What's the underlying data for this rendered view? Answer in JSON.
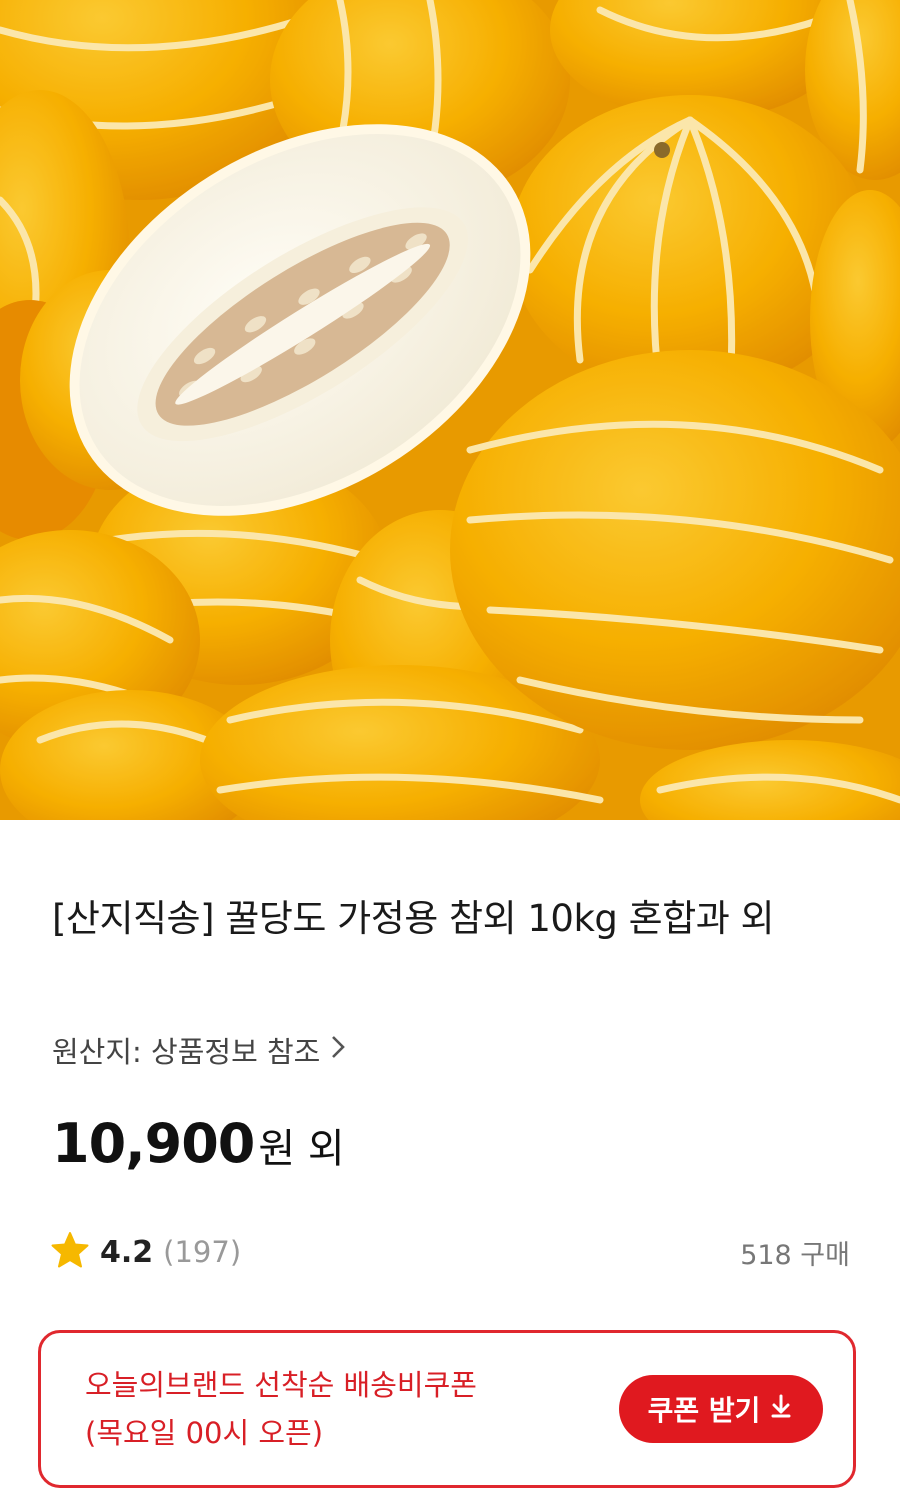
{
  "product": {
    "title": "[산지직송] 꿀당도 가정용 참외 10kg 혼합과 외",
    "origin": "원산지: 상품정보 참조",
    "price": "10,900",
    "price_suffix": "원 외",
    "rating": "4.2",
    "review_count": "(197)",
    "purchase_count": "518 구매"
  },
  "coupon": {
    "line1": "오늘의브랜드 선착순 배송비쿠폰",
    "line2": "(목요일 00시 오픈)",
    "button_label": "쿠폰 받기"
  },
  "icons": {
    "origin_chevron": "chevron-right-icon",
    "rating_star": "star-icon",
    "coupon_download": "download-arrow-icon"
  },
  "colors": {
    "accent_red": "#e0191f",
    "star_yellow": "#f6b800",
    "melon_yellow": "#f7b400"
  }
}
